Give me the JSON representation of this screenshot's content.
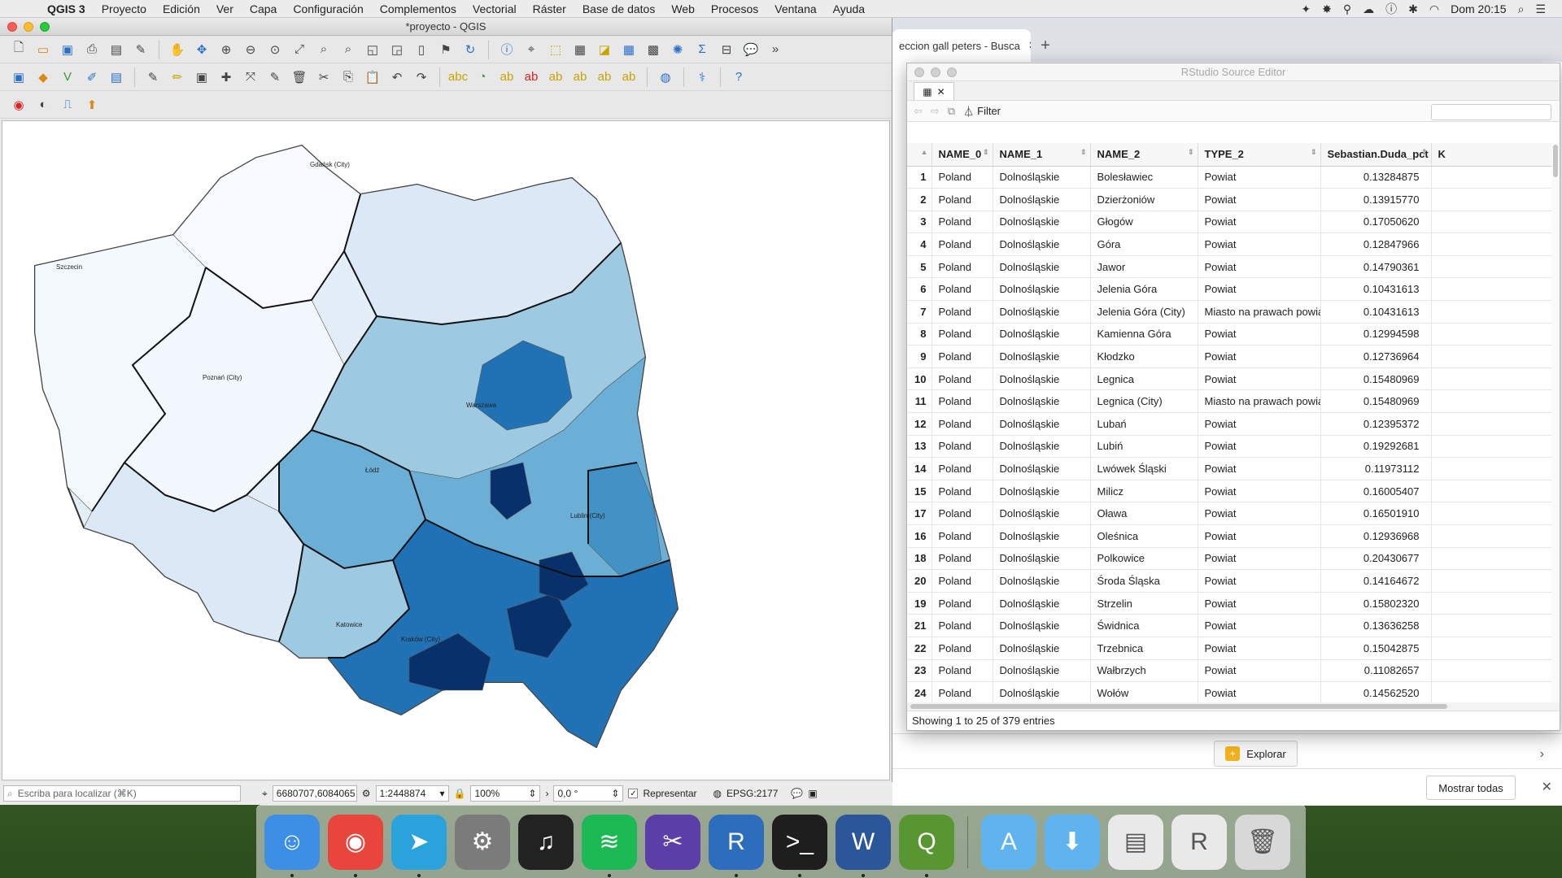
{
  "menubar": {
    "app_name": "QGIS 3",
    "menus": [
      "Proyecto",
      "Edición",
      "Ver",
      "Capa",
      "Configuración",
      "Complementos",
      "Vectorial",
      "Ráster",
      "Base de datos",
      "Web",
      "Procesos",
      "Ventana",
      "Ayuda"
    ],
    "clock": "Dom 20:15"
  },
  "qgis": {
    "window_title": "*proyecto - QGIS",
    "statusbar": {
      "locator_placeholder": "Escriba para localizar (⌘K)",
      "coordinate": "6680707,6084065",
      "scale": "1:2448874",
      "magnifier": "100%",
      "rotation": "0,0 °",
      "render_label": "Representar",
      "crs": "EPSG:2177"
    },
    "map": {
      "city_labels": [
        "Gdańsk (City)",
        "Szczecin",
        "Poznań (City)",
        "Warszawa",
        "Łódź",
        "Lublin (City)",
        "Katowice",
        "Kraków (City)"
      ],
      "colors": {
        "c1": "#f7fbff",
        "c2": "#c6dbef",
        "c3": "#9ecae1",
        "c4": "#4292c6",
        "c5": "#2171b5",
        "c6": "#08306b"
      }
    }
  },
  "browser": {
    "tab_title": "eccion gall peters - Busca",
    "explore_label": "Explorar",
    "show_all_label": "Mostrar todas"
  },
  "rstudio": {
    "window_title": "RStudio Source Editor",
    "filter_label": "Filter",
    "columns": [
      "NAME_0",
      "NAME_1",
      "NAME_2",
      "TYPE_2",
      "Sebastian.Duda_pct",
      "K"
    ],
    "rows": [
      {
        "n": "1",
        "c0": "Poland",
        "c1": "Dolnośląskie",
        "c2": "Bolesławiec",
        "c3": "Powiat",
        "v": "0.13284875"
      },
      {
        "n": "2",
        "c0": "Poland",
        "c1": "Dolnośląskie",
        "c2": "Dzierżoniów",
        "c3": "Powiat",
        "v": "0.13915770"
      },
      {
        "n": "3",
        "c0": "Poland",
        "c1": "Dolnośląskie",
        "c2": "Głogów",
        "c3": "Powiat",
        "v": "0.17050620"
      },
      {
        "n": "4",
        "c0": "Poland",
        "c1": "Dolnośląskie",
        "c2": "Góra",
        "c3": "Powiat",
        "v": "0.12847966"
      },
      {
        "n": "5",
        "c0": "Poland",
        "c1": "Dolnośląskie",
        "c2": "Jawor",
        "c3": "Powiat",
        "v": "0.14790361"
      },
      {
        "n": "6",
        "c0": "Poland",
        "c1": "Dolnośląskie",
        "c2": "Jelenia Góra",
        "c3": "Powiat",
        "v": "0.10431613"
      },
      {
        "n": "7",
        "c0": "Poland",
        "c1": "Dolnośląskie",
        "c2": "Jelenia Góra (City)",
        "c3": "Miasto na prawach powiatu",
        "v": "0.10431613"
      },
      {
        "n": "8",
        "c0": "Poland",
        "c1": "Dolnośląskie",
        "c2": "Kamienna Góra",
        "c3": "Powiat",
        "v": "0.12994598"
      },
      {
        "n": "9",
        "c0": "Poland",
        "c1": "Dolnośląskie",
        "c2": "Kłodzko",
        "c3": "Powiat",
        "v": "0.12736964"
      },
      {
        "n": "10",
        "c0": "Poland",
        "c1": "Dolnośląskie",
        "c2": "Legnica",
        "c3": "Powiat",
        "v": "0.15480969"
      },
      {
        "n": "11",
        "c0": "Poland",
        "c1": "Dolnośląskie",
        "c2": "Legnica (City)",
        "c3": "Miasto na prawach powiatu",
        "v": "0.15480969"
      },
      {
        "n": "12",
        "c0": "Poland",
        "c1": "Dolnośląskie",
        "c2": "Lubań",
        "c3": "Powiat",
        "v": "0.12395372"
      },
      {
        "n": "13",
        "c0": "Poland",
        "c1": "Dolnośląskie",
        "c2": "Lubiń",
        "c3": "Powiat",
        "v": "0.19292681"
      },
      {
        "n": "14",
        "c0": "Poland",
        "c1": "Dolnośląskie",
        "c2": "Lwówek Śląski",
        "c3": "Powiat",
        "v": "0.11973112"
      },
      {
        "n": "15",
        "c0": "Poland",
        "c1": "Dolnośląskie",
        "c2": "Milicz",
        "c3": "Powiat",
        "v": "0.16005407"
      },
      {
        "n": "17",
        "c0": "Poland",
        "c1": "Dolnośląskie",
        "c2": "Oława",
        "c3": "Powiat",
        "v": "0.16501910"
      },
      {
        "n": "16",
        "c0": "Poland",
        "c1": "Dolnośląskie",
        "c2": "Oleśnica",
        "c3": "Powiat",
        "v": "0.12936968"
      },
      {
        "n": "18",
        "c0": "Poland",
        "c1": "Dolnośląskie",
        "c2": "Polkowice",
        "c3": "Powiat",
        "v": "0.20430677"
      },
      {
        "n": "20",
        "c0": "Poland",
        "c1": "Dolnośląskie",
        "c2": "Środa Śląska",
        "c3": "Powiat",
        "v": "0.14164672"
      },
      {
        "n": "19",
        "c0": "Poland",
        "c1": "Dolnośląskie",
        "c2": "Strzelin",
        "c3": "Powiat",
        "v": "0.15802320"
      },
      {
        "n": "21",
        "c0": "Poland",
        "c1": "Dolnośląskie",
        "c2": "Świdnica",
        "c3": "Powiat",
        "v": "0.13636258"
      },
      {
        "n": "22",
        "c0": "Poland",
        "c1": "Dolnośląskie",
        "c2": "Trzebnica",
        "c3": "Powiat",
        "v": "0.15042875"
      },
      {
        "n": "23",
        "c0": "Poland",
        "c1": "Dolnośląskie",
        "c2": "Wałbrzych",
        "c3": "Powiat",
        "v": "0.11082657"
      },
      {
        "n": "24",
        "c0": "Poland",
        "c1": "Dolnośląskie",
        "c2": "Wołów",
        "c3": "Powiat",
        "v": "0.14562520"
      }
    ],
    "footer": "Showing 1 to 25 of 379 entries"
  },
  "dock": {
    "apps": [
      {
        "name": "finder-icon",
        "glyph": "☺",
        "color": "#3d8fe6",
        "running": true
      },
      {
        "name": "chrome-icon",
        "glyph": "◉",
        "color": "#e8453c",
        "running": true
      },
      {
        "name": "telegram-icon",
        "glyph": "➤",
        "color": "#2aa3dd",
        "running": true
      },
      {
        "name": "system-preferences-icon",
        "glyph": "⚙",
        "color": "#7b7b7b",
        "running": false
      },
      {
        "name": "piano-icon",
        "glyph": "♫",
        "color": "#222222",
        "running": false
      },
      {
        "name": "spotify-icon",
        "glyph": "≋",
        "color": "#1db954",
        "running": true
      },
      {
        "name": "final-cut-icon",
        "glyph": "✂",
        "color": "#5b3ea8",
        "running": false
      },
      {
        "name": "r-icon",
        "glyph": "R",
        "color": "#2c6dbe",
        "running": true
      },
      {
        "name": "terminal-icon",
        "glyph": ">_",
        "color": "#1e1e1e",
        "running": true
      },
      {
        "name": "word-icon",
        "glyph": "W",
        "color": "#2b579a",
        "running": true
      },
      {
        "name": "qgis-icon",
        "glyph": "Q",
        "color": "#589632",
        "running": true
      }
    ],
    "folders": [
      {
        "name": "applications-folder-icon",
        "glyph": "A",
        "color": "#5fb4f0"
      },
      {
        "name": "downloads-folder-icon",
        "glyph": "⬇",
        "color": "#5fb4f0"
      },
      {
        "name": "document-stack-icon",
        "glyph": "▤",
        "color": "#e9e9e9"
      },
      {
        "name": "rstudio-document-icon",
        "glyph": "R",
        "color": "#e9e9e9"
      },
      {
        "name": "trash-icon",
        "glyph": "🗑",
        "color": "#d8d8d8"
      }
    ]
  }
}
